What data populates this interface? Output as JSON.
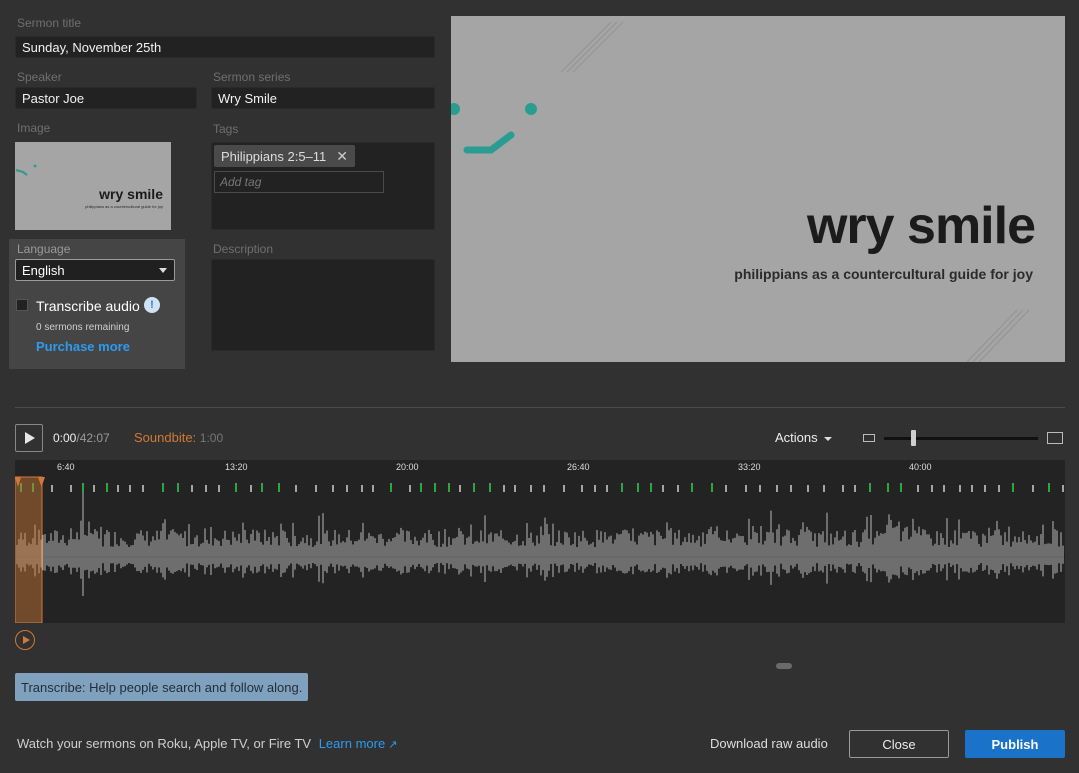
{
  "form": {
    "sermon_title_label": "Sermon title",
    "sermon_title_value": "Sunday, November 25th",
    "speaker_label": "Speaker",
    "speaker_value": "Pastor Joe",
    "series_label": "Sermon series",
    "series_value": "Wry Smile",
    "image_label": "Image",
    "tags_label": "Tags",
    "tags": [
      "Philippians 2:5–11"
    ],
    "add_tag_placeholder": "Add tag",
    "description_label": "Description",
    "language_label": "Language",
    "language_value": "English",
    "transcribe_label": "Transcribe audio",
    "transcribe_checked": false,
    "remaining": "0 sermons remaining",
    "purchase_more": "Purchase more"
  },
  "artwork": {
    "title": "wry smile",
    "subtitle": "philippians as a countercultural guide for joy",
    "accent": "#2b9c92"
  },
  "player": {
    "current_time": "0:00",
    "total_time": "/42:07",
    "soundbite_label": "Soundbite:",
    "soundbite_value": "1:00",
    "actions_label": "Actions",
    "zoom_level": 0.18,
    "timeline_ticks": [
      "6:40",
      "13:20",
      "20:00",
      "26:40",
      "33:20",
      "40:00"
    ]
  },
  "transcribe_banner": "Transcribe: Help people search and follow along.",
  "footer": {
    "promo_text": "Watch your sermons on Roku, Apple TV, or Fire TV",
    "learn_more": "Learn more",
    "download_raw": "Download raw audio",
    "close": "Close",
    "publish": "Publish"
  },
  "colors": {
    "background": "#313131",
    "field": "#222222",
    "link": "#2c9bf0",
    "soundbite": "#d07a35",
    "publish": "#1a72c9",
    "marker_green": "#35d04b"
  }
}
